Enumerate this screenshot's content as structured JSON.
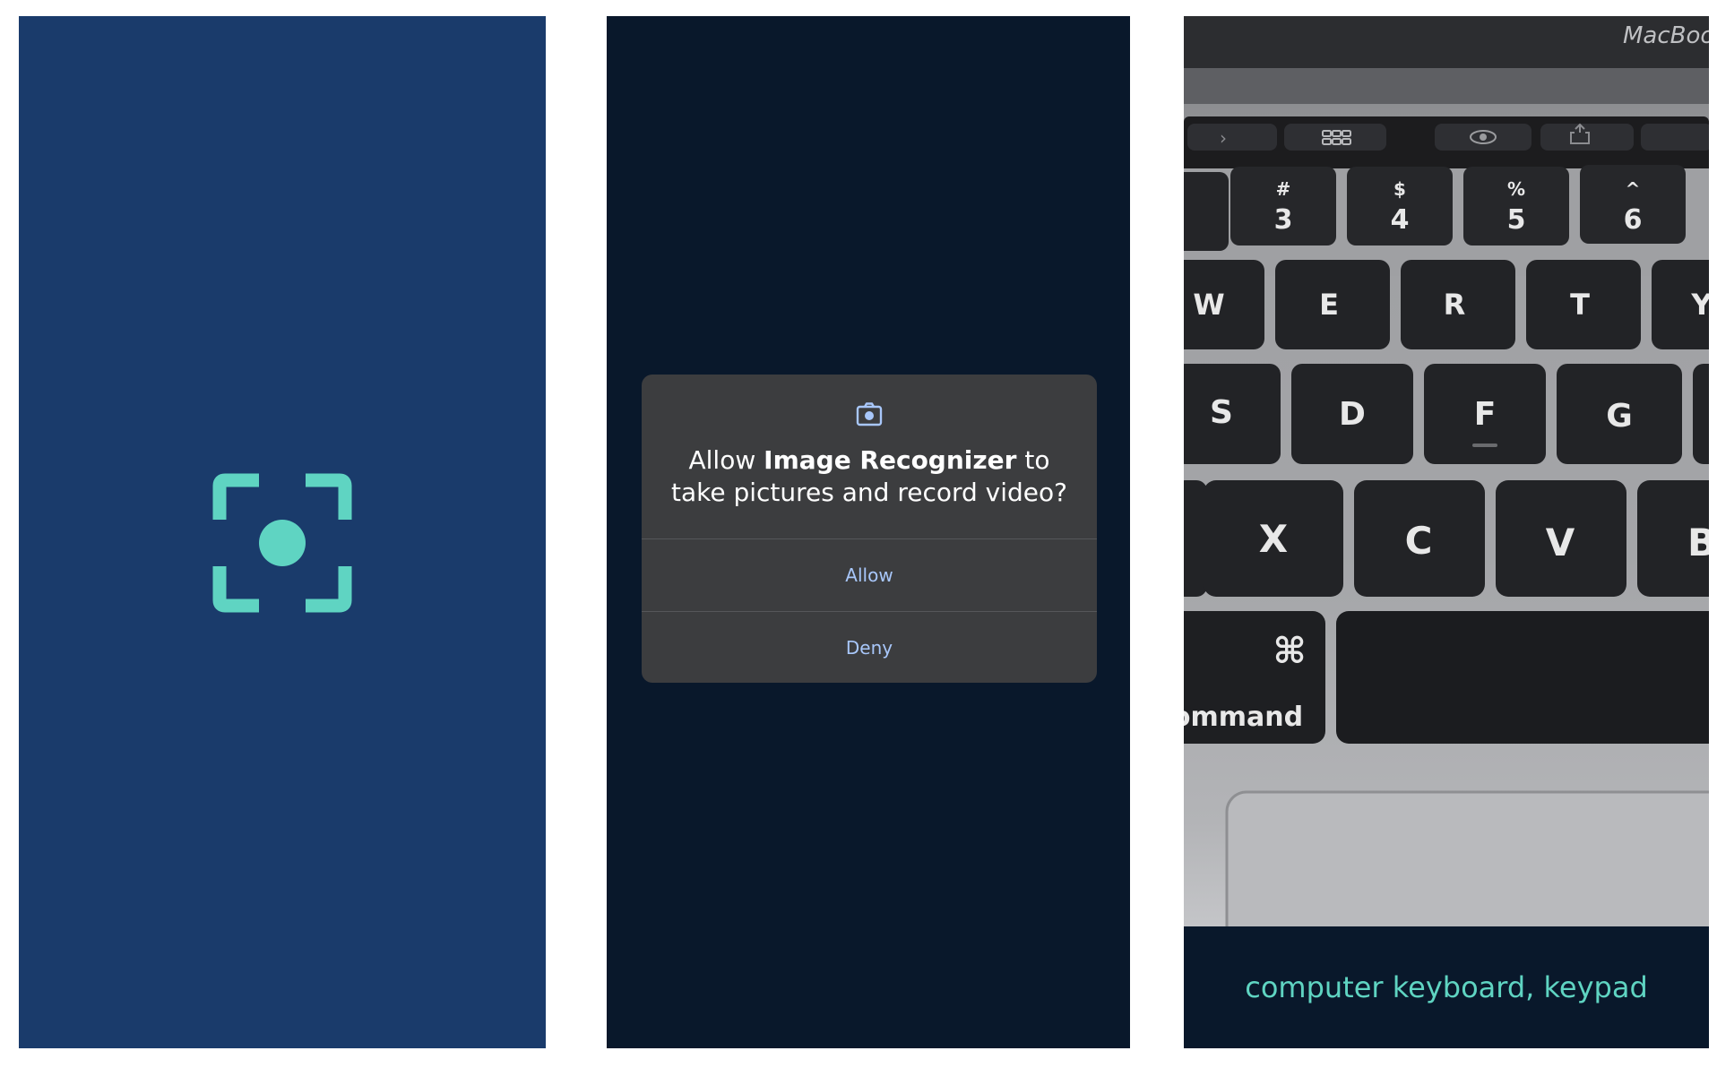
{
  "colors": {
    "splash_background": "#1a3b6b",
    "splash_icon": "#5fd4c2",
    "dialog_screen_background": "#09182b",
    "dialog_background": "#3c3d3f",
    "dialog_button_text": "#a8c7fa",
    "result_text": "#5fd4c2"
  },
  "splash": {
    "icon": "camera-focus-icon"
  },
  "permission_dialog": {
    "icon": "camera-icon",
    "title_prefix": "Allow ",
    "app_name": "Image Recognizer",
    "title_suffix": " to take pictures and record video?",
    "allow_label": "Allow",
    "deny_label": "Deny"
  },
  "camera": {
    "keyboard_brand": "MacBoo",
    "number_keys": [
      {
        "symbol": "#",
        "digit": "3"
      },
      {
        "symbol": "$",
        "digit": "4"
      },
      {
        "symbol": "%",
        "digit": "5"
      },
      {
        "symbol": "^",
        "digit": "6"
      }
    ],
    "row_qwerty": [
      "W",
      "E",
      "R",
      "T",
      "Y"
    ],
    "row_asdf": [
      "S",
      "D",
      "F",
      "G"
    ],
    "row_zxcv": [
      "X",
      "C",
      "V",
      "B"
    ],
    "command_symbol": "⌘",
    "command_label": "ommand",
    "result_label": "computer keyboard, keypad"
  }
}
